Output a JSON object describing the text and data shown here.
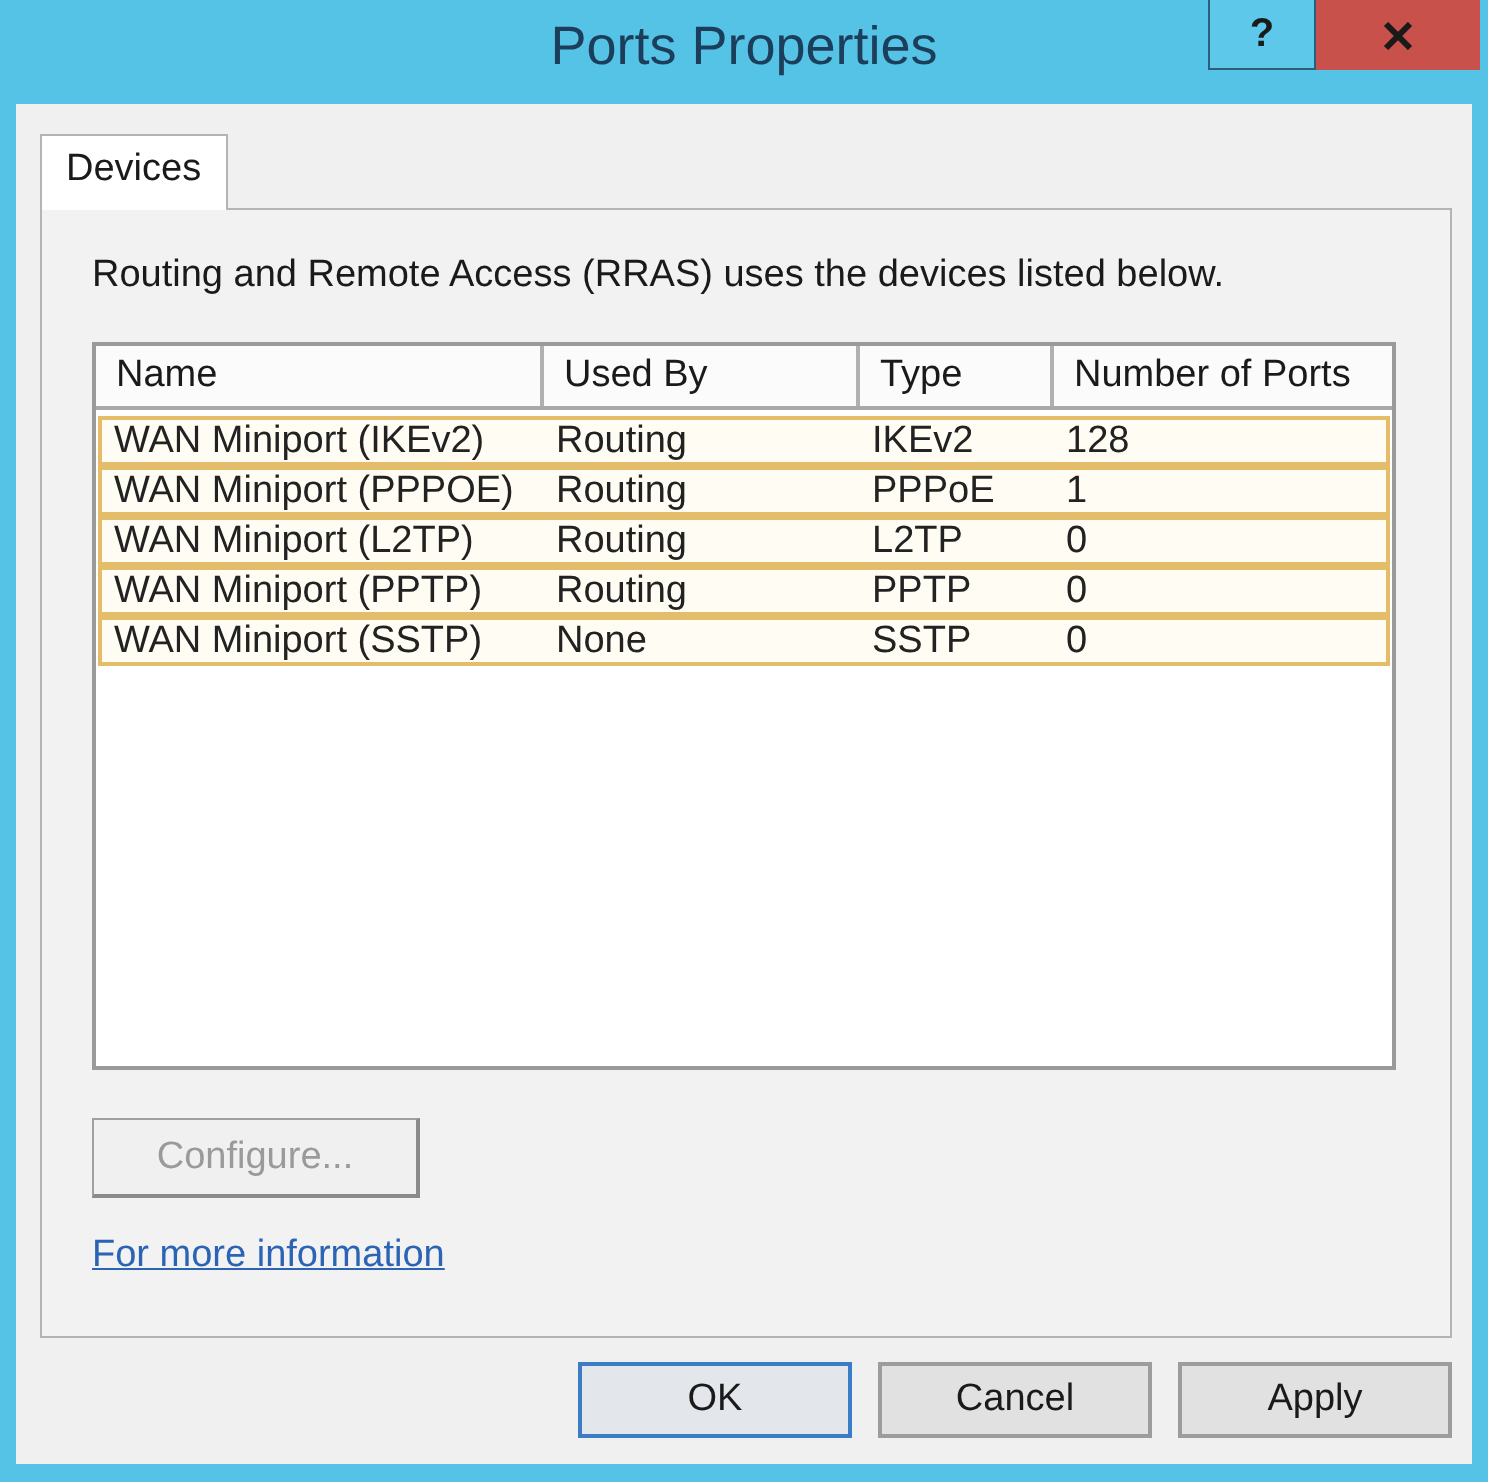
{
  "window": {
    "title": "Ports Properties"
  },
  "title_buttons": [
    {
      "kind": "help",
      "label": "?"
    },
    {
      "kind": "close"
    }
  ],
  "tabs": [
    {
      "label": "Devices",
      "selected": true
    }
  ],
  "description": "Routing and Remote Access (RRAS) uses the devices listed below.",
  "table": {
    "columns": [
      "Name",
      "Used By",
      "Type",
      "Number of Ports"
    ],
    "rows": [
      {
        "cells": [
          "WAN Miniport (IKEv2)",
          "Routing",
          "IKEv2",
          "128"
        ],
        "selected": true
      },
      {
        "cells": [
          "WAN Miniport (PPPOE)",
          "Routing",
          "PPPoE",
          "1"
        ],
        "selected": true
      },
      {
        "cells": [
          "WAN Miniport (L2TP)",
          "Routing",
          "L2TP",
          "0"
        ],
        "selected": true
      },
      {
        "cells": [
          "WAN Miniport (PPTP)",
          "Routing",
          "PPTP",
          "0"
        ],
        "selected": true
      },
      {
        "cells": [
          "WAN Miniport (SSTP)",
          "None",
          "SSTP",
          "0"
        ],
        "selected": true
      }
    ]
  },
  "configure_button": {
    "label": "Configure...",
    "disabled": true
  },
  "link": "For more information",
  "buttons": [
    {
      "label": "OK",
      "default": true
    },
    {
      "label": "Cancel",
      "default": false
    },
    {
      "label": "Apply",
      "default": false
    }
  ]
}
